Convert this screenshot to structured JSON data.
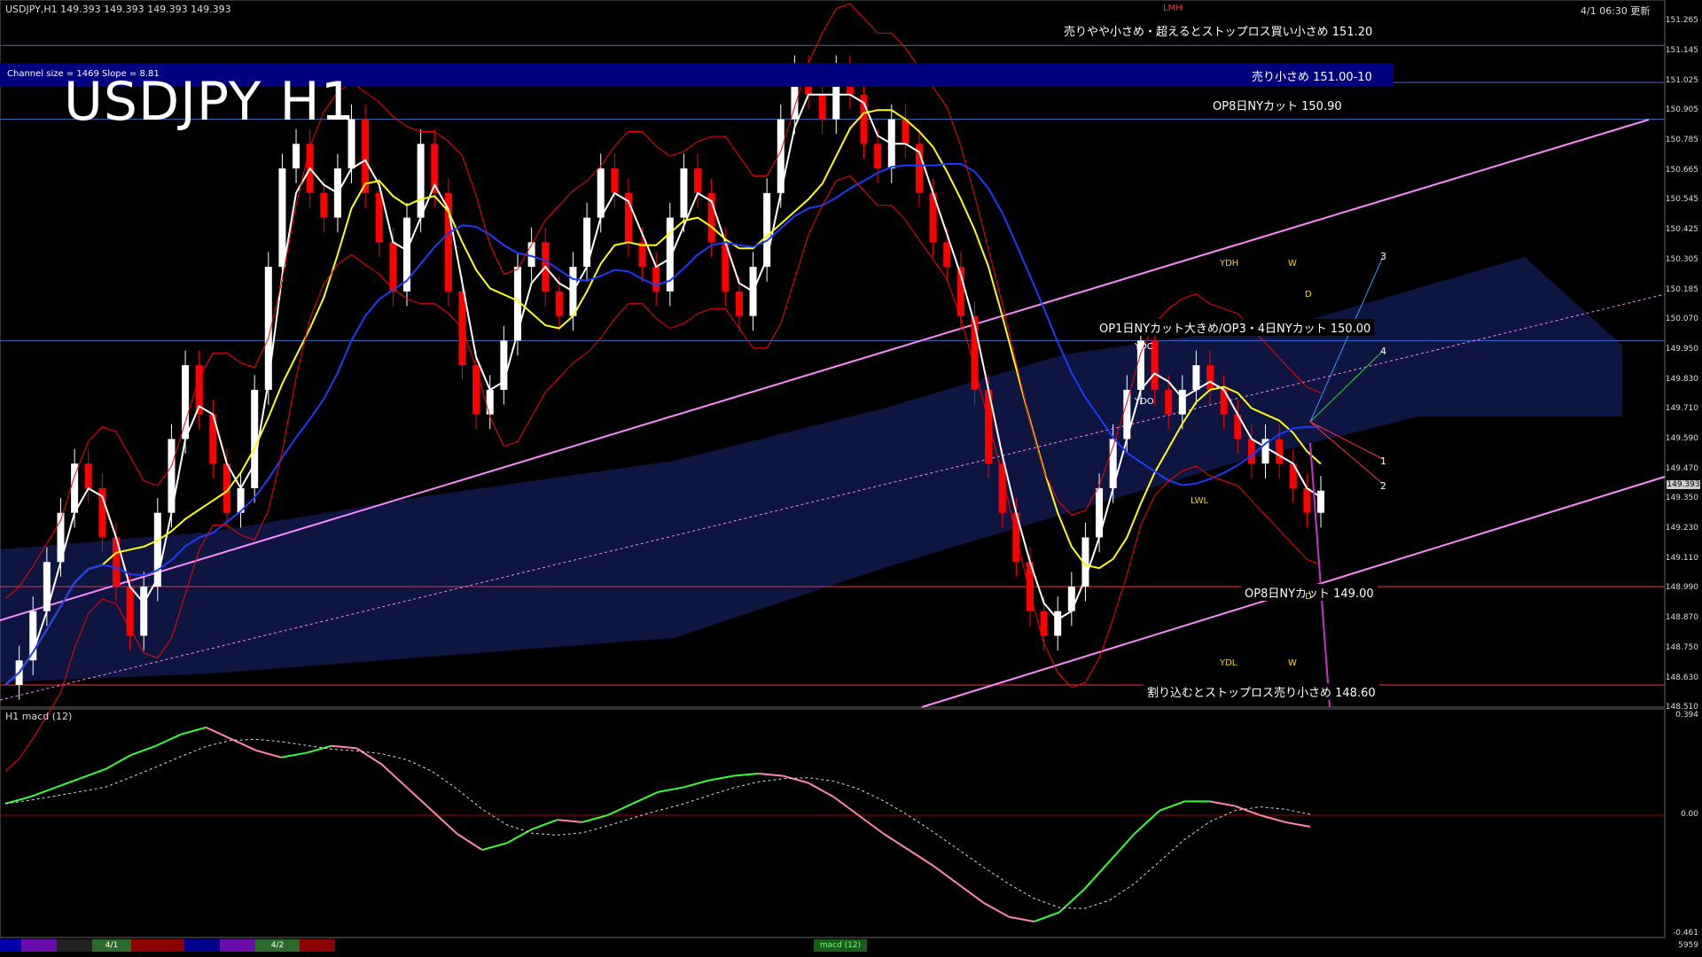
{
  "header": {
    "symbol_info": "USDJPY,H1  149.393 149.393 149.393 149.393",
    "updated": "4/1 06:30 更新",
    "big_title": "USDJPY H1",
    "channel_info": "Channel size = 1469 Slope = 8.81",
    "macd_label": "H1  macd (12)"
  },
  "annotations": [
    {
      "text": "売りやや小さめ・超えるとストップロス買い小さめ 151.20",
      "price": 151.2
    },
    {
      "text": "売り小さめ 151.00-10",
      "price": 151.05
    },
    {
      "text": "OP8日NYカット 150.90",
      "price": 150.9
    },
    {
      "text": "OP1日NYカット大きめ/OP3・4日NYカット 150.00",
      "price": 150.0
    },
    {
      "text": "OP8日NYカット 149.00",
      "price": 149.0
    },
    {
      "text": "割り込むとストップロス売り小さめ 148.60",
      "price": 148.6
    }
  ],
  "box_labels": [
    "LMH",
    "YDH",
    "W",
    "D",
    "YDC",
    "YDO",
    "LWL",
    "YDL",
    "W",
    "D"
  ],
  "projection_labels": [
    "3",
    "4",
    "1",
    "2"
  ],
  "price_axis": {
    "ticks": [
      "151.265",
      "151.145",
      "151.025",
      "150.905",
      "150.785",
      "150.665",
      "150.545",
      "150.425",
      "150.305",
      "150.185",
      "150.070",
      "149.950",
      "149.830",
      "149.710",
      "149.590",
      "149.470",
      "149.350",
      "149.230",
      "149.110",
      "148.990",
      "148.870",
      "148.750",
      "148.630",
      "148.510"
    ],
    "current": "149.393",
    "macd_ticks": [
      "0.394",
      "0.00",
      "-0.461"
    ]
  },
  "bottom_strip": {
    "labels": [
      "4/1",
      "4/2",
      "macd (12)",
      "5959"
    ]
  },
  "colors": {
    "background": "#000000",
    "candle_up": "#ffffff",
    "candle_down": "#ff0000",
    "ma_short": "#ffffff",
    "ma_mid": "#ffff00",
    "ma_long": "#1a3cff",
    "bollinger": "#ff0000",
    "chikou": "#00cc00",
    "cloud": "#3355ff",
    "channel": "#ff88ff",
    "level_line": "#3b6fc4",
    "red_level": "#ff3333",
    "macd_main_up": "#33ff33",
    "macd_main_down": "#ff88aa"
  },
  "chart_data": {
    "type": "candlestick",
    "title": "USDJPY H1",
    "ylim": [
      148.51,
      151.32
    ],
    "close_series": [
      148.6,
      148.7,
      148.9,
      149.1,
      149.3,
      149.5,
      149.4,
      149.2,
      149.0,
      148.8,
      149.0,
      149.3,
      149.6,
      149.9,
      149.7,
      149.5,
      149.3,
      149.4,
      149.8,
      150.3,
      150.7,
      150.8,
      150.6,
      150.5,
      150.7,
      150.9,
      150.6,
      150.4,
      150.2,
      150.5,
      150.8,
      150.6,
      150.2,
      149.9,
      149.7,
      149.8,
      150.0,
      150.3,
      150.4,
      150.2,
      150.1,
      150.3,
      150.5,
      150.7,
      150.6,
      150.4,
      150.3,
      150.2,
      150.5,
      150.7,
      150.6,
      150.4,
      150.2,
      150.1,
      150.3,
      150.6,
      150.9,
      151.1,
      151.0,
      150.9,
      151.1,
      151.0,
      150.8,
      150.7,
      150.9,
      150.8,
      150.6,
      150.4,
      150.3,
      150.1,
      149.8,
      149.5,
      149.3,
      149.1,
      148.9,
      148.8,
      148.9,
      149.0,
      149.2,
      149.4,
      149.6,
      149.8,
      150.0,
      149.8,
      149.7,
      149.8,
      149.9,
      149.8,
      149.7,
      149.6,
      149.5,
      149.6,
      149.5,
      149.4,
      149.3,
      149.39
    ],
    "macd": [
      0.05,
      0.08,
      0.12,
      0.16,
      0.2,
      0.26,
      0.3,
      0.35,
      0.38,
      0.33,
      0.28,
      0.25,
      0.27,
      0.3,
      0.29,
      0.22,
      0.12,
      0.02,
      -0.08,
      -0.15,
      -0.12,
      -0.06,
      -0.02,
      -0.03,
      0.0,
      0.05,
      0.1,
      0.12,
      0.15,
      0.17,
      0.18,
      0.17,
      0.14,
      0.08,
      0.0,
      -0.08,
      -0.15,
      -0.22,
      -0.3,
      -0.38,
      -0.44,
      -0.46,
      -0.42,
      -0.32,
      -0.2,
      -0.08,
      0.02,
      0.06,
      0.06,
      0.04,
      0.0,
      -0.03,
      -0.05
    ]
  }
}
